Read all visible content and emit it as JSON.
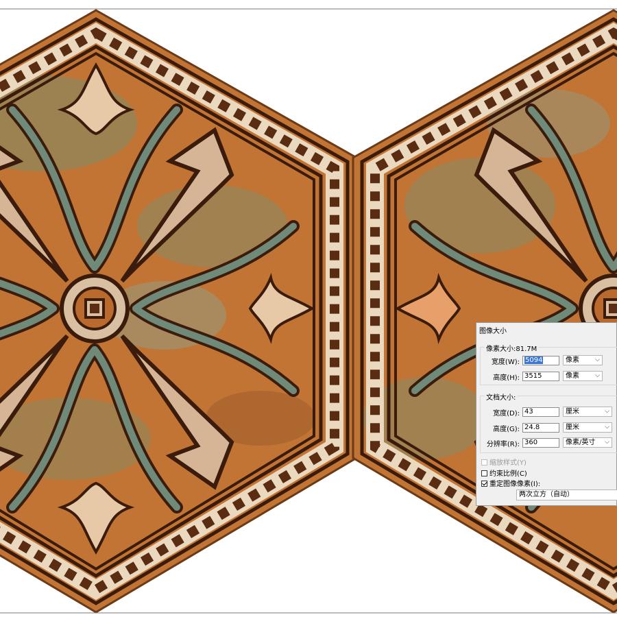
{
  "dialog": {
    "title": "图像大小",
    "pixel_group": {
      "legend": "像素大小:81.7M",
      "width": {
        "label": "宽度(W):",
        "value": "5094",
        "unit": "像素"
      },
      "height": {
        "label": "高度(H):",
        "value": "3515",
        "unit": "像素"
      }
    },
    "doc_group": {
      "legend": "文档大小:",
      "width": {
        "label": "宽度(D):",
        "value": "43",
        "unit": "厘米"
      },
      "height": {
        "label": "高度(G):",
        "value": "24.8",
        "unit": "厘米"
      },
      "resolution": {
        "label": "分辨率(R):",
        "value": "360",
        "unit": "像素/英寸"
      }
    },
    "options": {
      "scale_styles": {
        "label": "缩放样式(Y)",
        "checked": false,
        "enabled": false
      },
      "constrain": {
        "label": "约束比例(C)",
        "checked": false
      },
      "resample": {
        "label": "重定图像像素(I):",
        "checked": true
      }
    },
    "interpolation": "两次立方（自动）"
  },
  "icons": {
    "dropdown": "chevron-down-icon"
  },
  "colors": {
    "tile_base": "#c0702e",
    "tile_dark": "#4a2410",
    "tile_cream": "#e8d2b4",
    "tile_green": "#7f8e6a",
    "selection": "#3875d7"
  }
}
